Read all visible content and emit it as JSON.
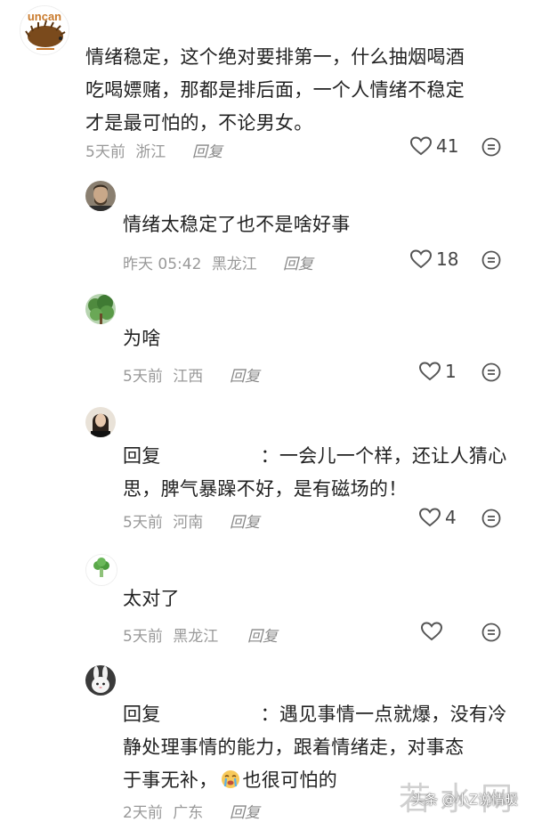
{
  "comments": [
    {
      "lines": [
        "情绪稳定，这个绝对要排第一，什么抽烟喝酒",
        "吃喝嫖赌，那都是排后面，一个人情绪不稳定",
        "才是最可怕的，不论男女。"
      ],
      "time": "5天前",
      "location": "浙江",
      "reply_label": "回复",
      "likes": "41",
      "avatar_icon": "hedgehog-logo-avatar",
      "avatar_logo_text": "uncan"
    },
    {
      "lines": [
        "情绪太稳定了也不是啥好事"
      ],
      "time": "昨天 05:42",
      "location": "黑龙江",
      "reply_label": "回复",
      "likes": "18",
      "avatar_icon": "man-avatar"
    },
    {
      "lines": [
        "为啥"
      ],
      "time": "5天前",
      "location": "江西",
      "reply_label": "回复",
      "likes": "1",
      "avatar_icon": "tree-avatar"
    },
    {
      "reply_prefix": "回复",
      "lines_after": [
        "：一会儿一个样，还让人猜心",
        "思，脾气暴躁不好，是有磁场的！"
      ],
      "time": "5天前",
      "location": "河南",
      "reply_label": "回复",
      "likes": "4",
      "avatar_icon": "woman-avatar"
    },
    {
      "lines": [
        "太对了"
      ],
      "time": "5天前",
      "location": "黑龙江",
      "reply_label": "回复",
      "likes": "",
      "avatar_icon": "broccoli-avatar"
    },
    {
      "reply_prefix": "回复",
      "lines_after": [
        "：遇见事情一点就爆，没有冷",
        "静处理事情的能力，跟着情绪走，对事态",
        "于事无补，",
        "也很可怕的"
      ],
      "time": "2天前",
      "location": "广东",
      "reply_label": "回复",
      "likes": "",
      "avatar_icon": "bunny-avatar"
    }
  ],
  "watermark": {
    "big": "若水网",
    "small": "头条 @小Z说情暖"
  },
  "colors": {
    "text": "#222222",
    "meta": "#999999",
    "icon": "#555555"
  }
}
